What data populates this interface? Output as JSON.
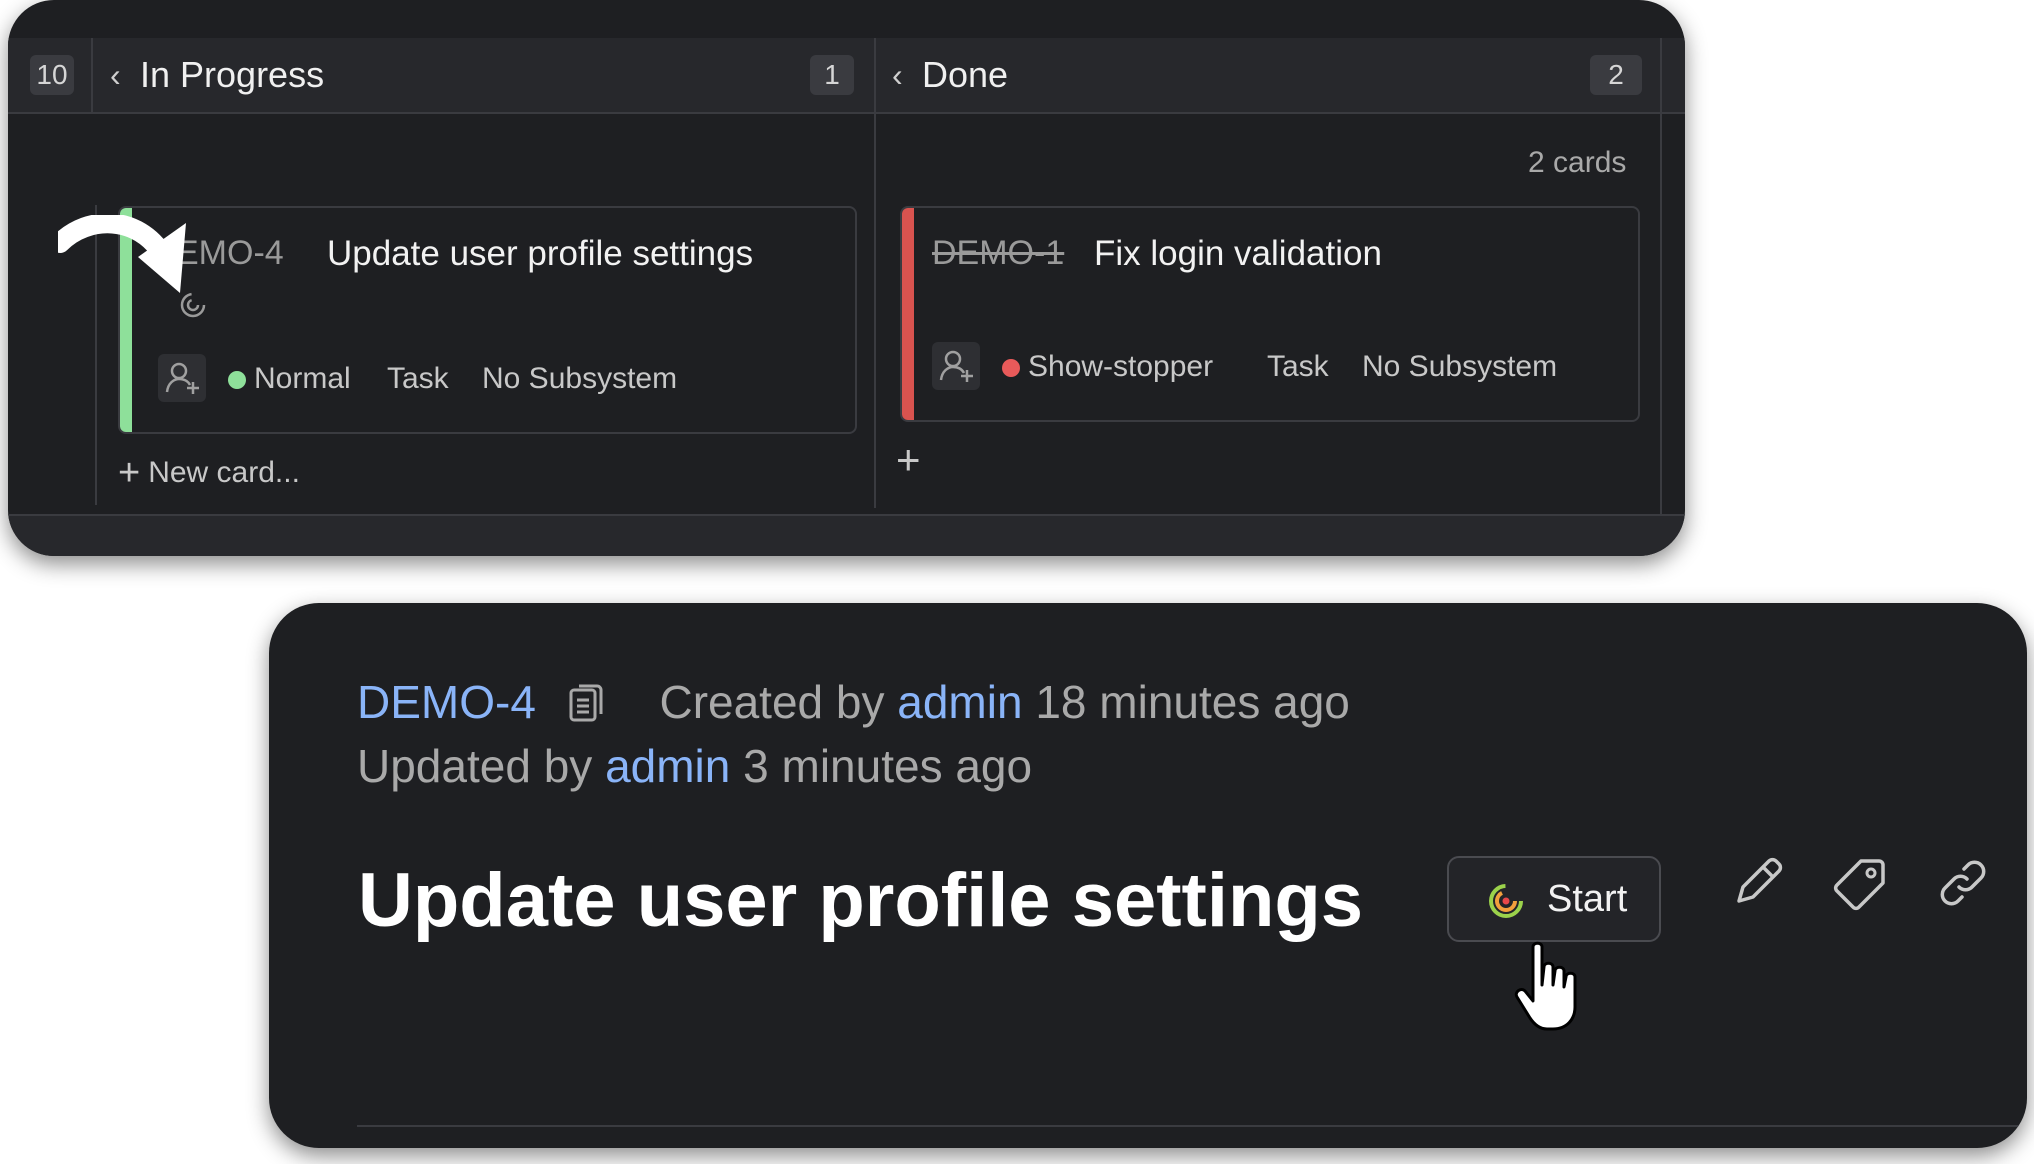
{
  "board": {
    "left_count": "10",
    "columns": [
      {
        "title": "In Progress",
        "count": "1"
      },
      {
        "title": "Done",
        "count": "2",
        "summary": "2 cards"
      }
    ],
    "new_card_label": "New card...",
    "cards": [
      {
        "id": "DEMO-4",
        "id_visible": "EMO-4",
        "title": "Update user profile settings",
        "priority": "Normal",
        "priority_color": "#8ee09a",
        "type": "Task",
        "subsystem": "No Subsystem",
        "stripe_color": "#8ee09a"
      },
      {
        "id": "DEMO-1",
        "title": "Fix login validation",
        "priority": "Show-stopper",
        "priority_color": "#e85a5a",
        "type": "Task",
        "subsystem": "No Subsystem",
        "stripe_color": "#d9534f",
        "resolved": true
      }
    ]
  },
  "detail": {
    "issue_id": "DEMO-4",
    "created_prefix": "Created by",
    "created_user": "admin",
    "created_time": "18 minutes ago",
    "updated_prefix": "Updated by",
    "updated_user": "admin",
    "updated_time": "3 minutes ago",
    "title": "Update user profile settings",
    "start_label": "Start",
    "tools": [
      "pencil-icon",
      "tag-icon",
      "link-icon"
    ]
  },
  "colors": {
    "panel_bg": "#1e1f22",
    "link": "#8ab4f8"
  }
}
